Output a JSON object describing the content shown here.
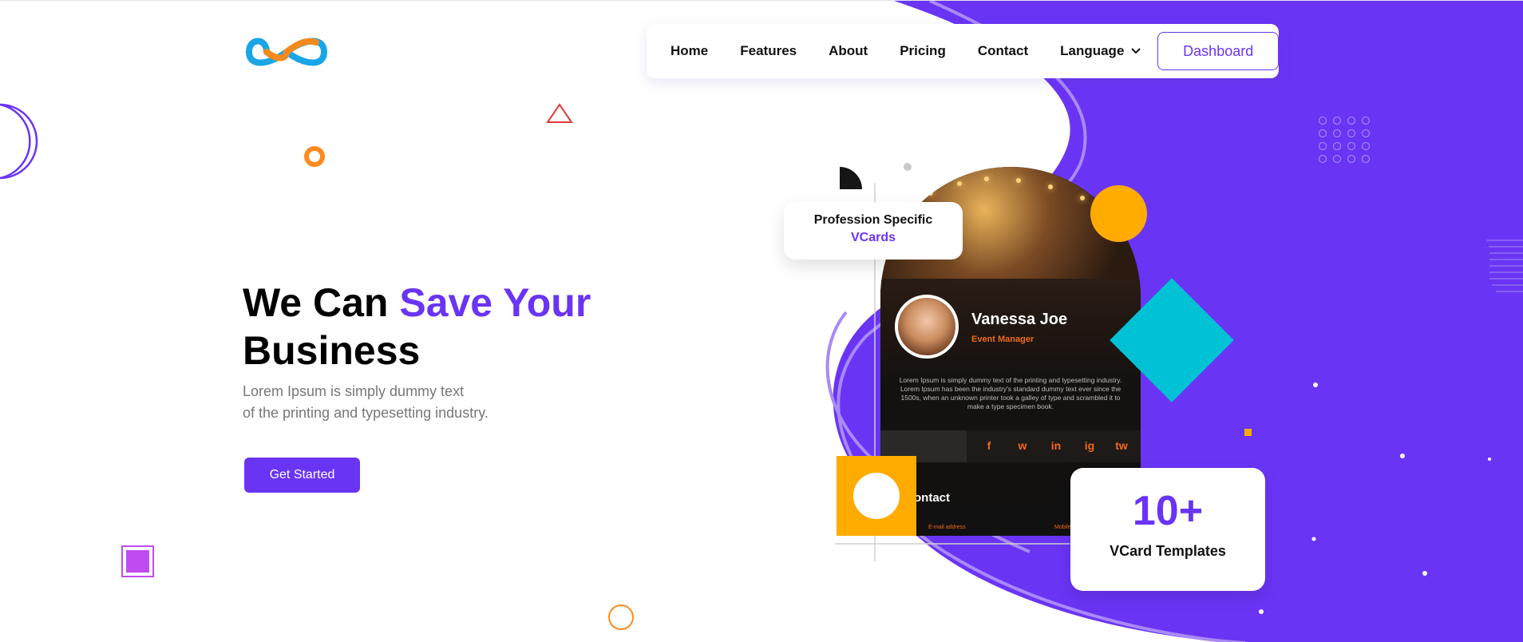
{
  "logo": {
    "icon": "infinity-logo-icon"
  },
  "nav": {
    "items": [
      "Home",
      "Features",
      "About",
      "Pricing",
      "Contact"
    ],
    "language_label": "Language",
    "dashboard_label": "Dashboard"
  },
  "hero": {
    "title_part1": "We Can ",
    "title_accent": "Save Your",
    "title_part2": "Business",
    "subtitle_line1": "Lorem Ipsum is simply dummy text",
    "subtitle_line2": "of the printing and typesetting industry.",
    "cta_label": "Get Started"
  },
  "vcard": {
    "name": "Vanessa Joe",
    "role": "Event Manager",
    "description": "Lorem Ipsum is simply dummy text of the printing and typesetting industry. Lorem Ipsum has been the industry's standard dummy text ever since the 1500s, when an unknown printer took a galley of type and scrambled it to make a type specimen book.",
    "social": [
      "f",
      "w",
      "in",
      "ig",
      "tw"
    ],
    "contact_label": "ontact",
    "email_label": "E-mail address",
    "mobile_label": "Mobile"
  },
  "profession_card": {
    "line1": "Profession Specific",
    "line2": "VCards"
  },
  "templates_card": {
    "number": "10+",
    "label": "VCard Templates"
  },
  "colors": {
    "accent": "#6a34f5",
    "orange": "#ffab00",
    "teal": "#00c2d4",
    "social": "#f06a1a"
  }
}
